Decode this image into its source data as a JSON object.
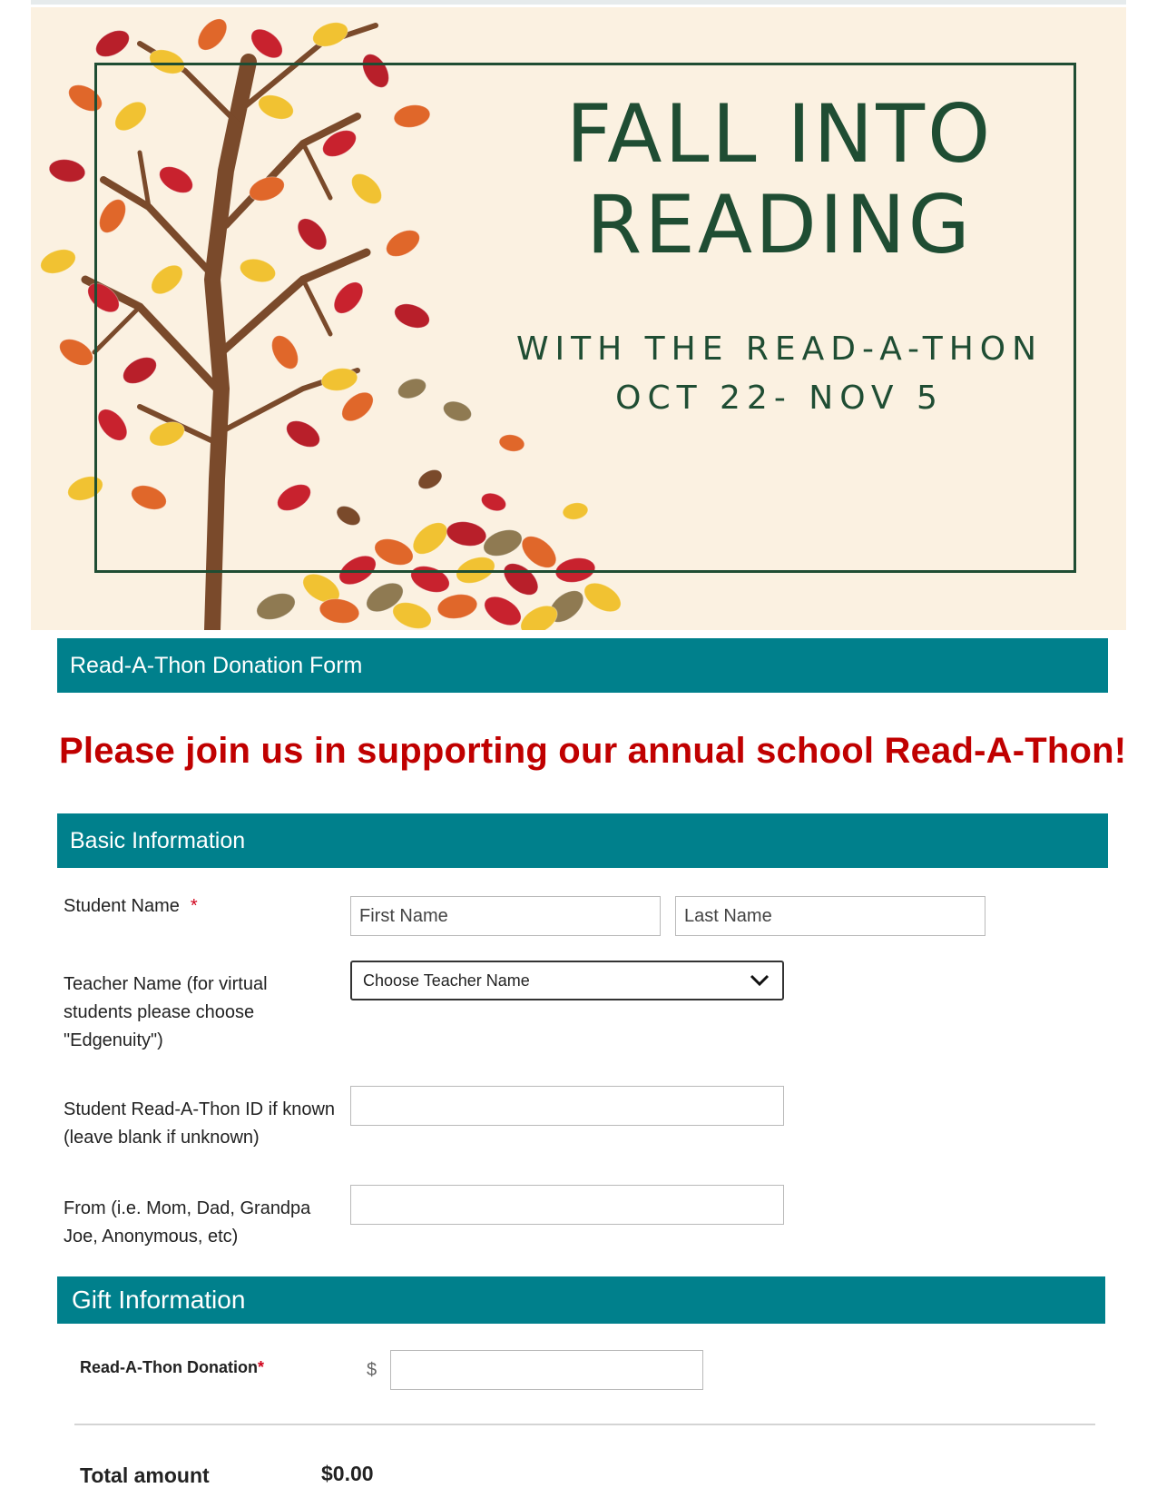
{
  "banner": {
    "title_line1": "FALL INTO",
    "title_line2": "READING",
    "subtitle_line1": "WITH THE READ-A-THON",
    "subtitle_line2": "OCT 22- NOV 5"
  },
  "form": {
    "title": "Read-A-Thon Donation Form",
    "promo": "Please join us in supporting our annual school Read-A-Thon!"
  },
  "basic": {
    "header": "Basic Information",
    "student_name_label": "Student Name",
    "required_mark": "*",
    "first_name_placeholder": "First Name",
    "last_name_placeholder": "Last Name",
    "teacher_label": "Teacher Name (for virtual students please choose \"Edgenuity\")",
    "teacher_select_value": "Choose Teacher Name",
    "student_id_label": "Student Read-A-Thon ID if known (leave blank if unknown)",
    "student_id_value": "",
    "from_label": "From (i.e. Mom, Dad, Grandpa Joe, Anonymous, etc)",
    "from_value": ""
  },
  "gift": {
    "header": "Gift Information",
    "donation_label": "Read-A-Thon Donation",
    "donation_required_mark": "*",
    "currency_symbol": "$",
    "donation_value": "",
    "total_label": "Total amount",
    "total_value": "$0.00"
  },
  "colors": {
    "accent": "#00808c",
    "promo_red": "#c00000",
    "banner_bg": "#fbf1e1",
    "banner_green": "#1f4d33"
  }
}
